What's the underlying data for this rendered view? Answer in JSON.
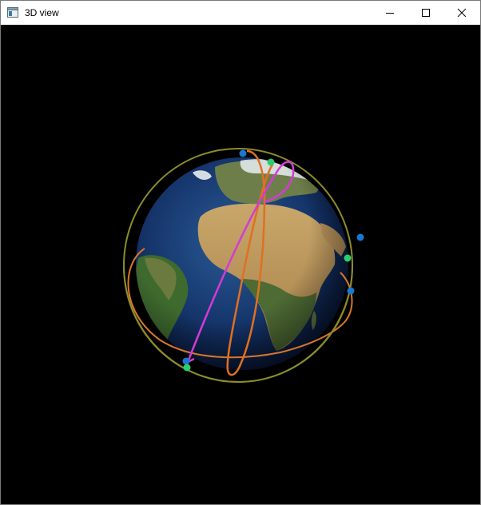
{
  "window": {
    "title": "3D view",
    "app_icon": "window-app-icon",
    "controls": {
      "minimize_icon": "minimize-icon",
      "maximize_icon": "maximize-icon",
      "close_icon": "close-icon"
    }
  },
  "scene": {
    "background": "#000000",
    "globe": "earth-globe",
    "orbits": [
      {
        "id": "orbit-olive",
        "color": "#8c8c2a"
      },
      {
        "id": "orbit-orange-equatorial",
        "color": "#d9762a"
      },
      {
        "id": "orbit-orange-polar",
        "color": "#e07020"
      },
      {
        "id": "orbit-magenta",
        "color": "#d33bd6"
      }
    ],
    "satellite_colors": {
      "blue": "#1a78d0",
      "green": "#2ecc71"
    }
  }
}
